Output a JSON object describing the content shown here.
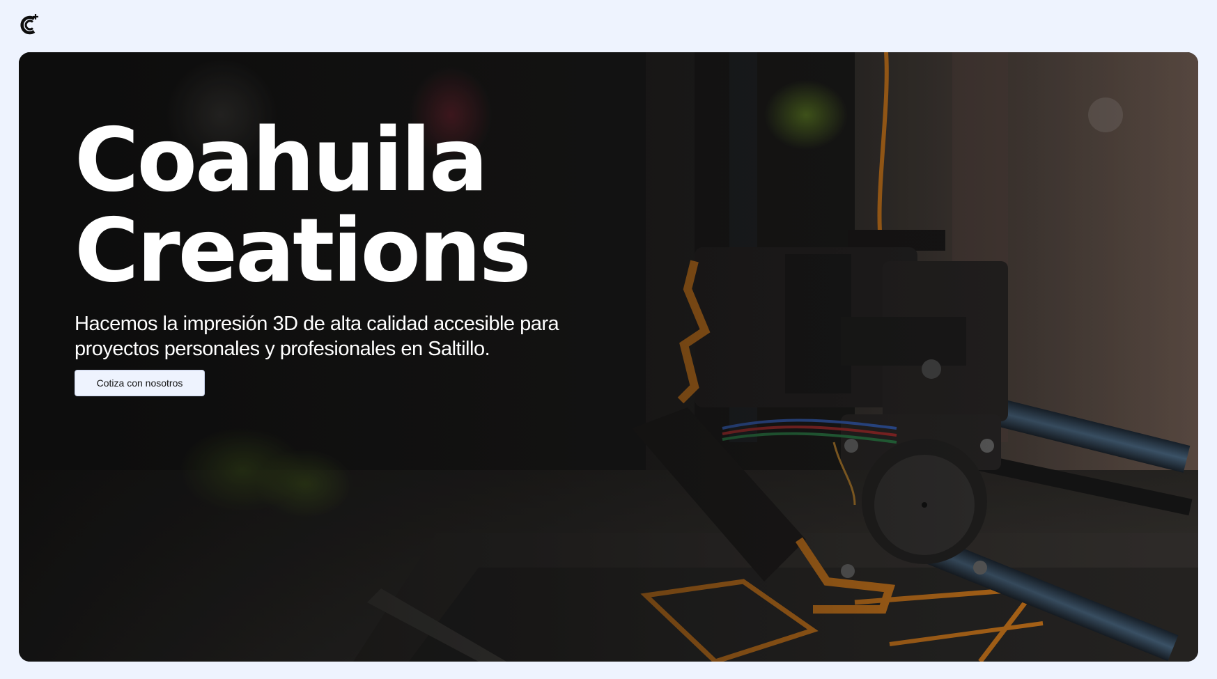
{
  "brand": {
    "logo_icon": "brand-c-logo-icon",
    "background_color": "#eef3fe"
  },
  "hero": {
    "title_line1": "Coahuila",
    "title_line2": "Creations",
    "subtitle": "Hacemos la impresión 3D de alta calidad accesible para proyectos personales y profesionales en Saltillo.",
    "cta_label": "Cotiza con nosotros",
    "image_subject": "3d-printer-extruder-photo"
  },
  "colors": {
    "accent_filament": "#f08a1c",
    "text": "#ffffff"
  }
}
